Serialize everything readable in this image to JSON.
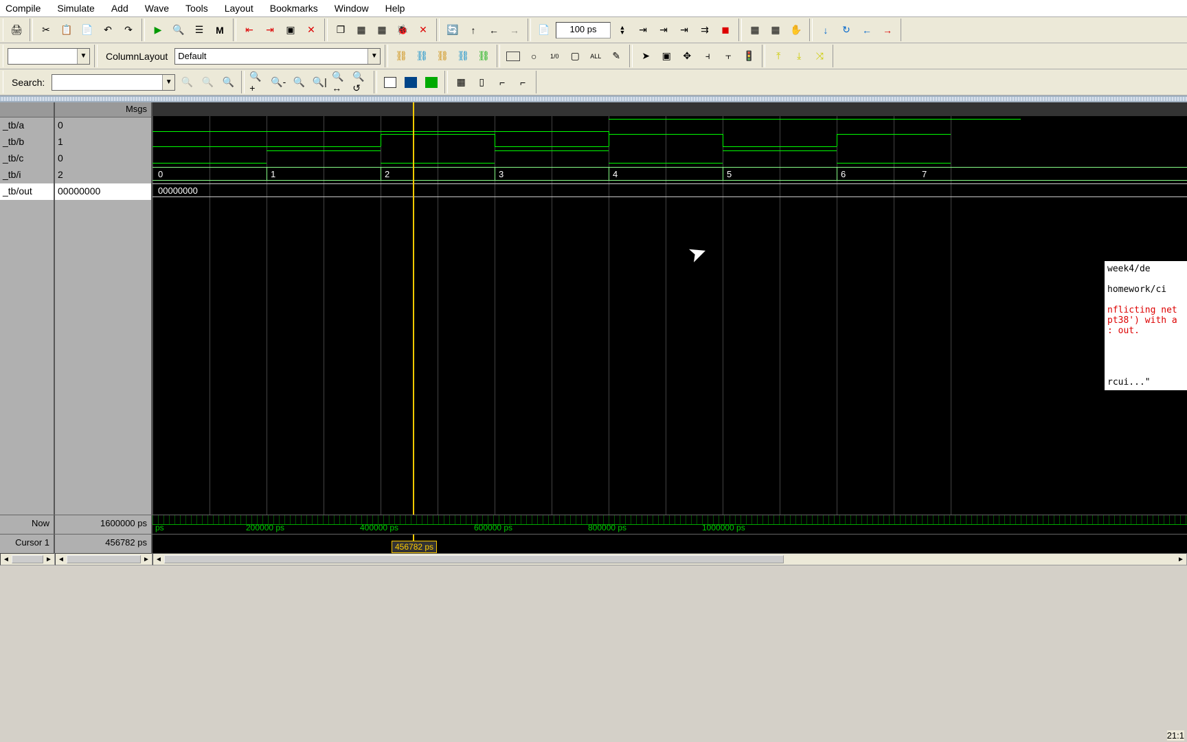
{
  "menu": [
    "Compile",
    "Simulate",
    "Add",
    "Wave",
    "Tools",
    "Layout",
    "Bookmarks",
    "Window",
    "Help"
  ],
  "toolbar": {
    "time_value": "100 ps",
    "column_layout_label": "ColumnLayout",
    "column_layout_value": "Default",
    "search_label": "Search:"
  },
  "signals": {
    "header": "Msgs",
    "rows": [
      {
        "name": "_tb/a",
        "val": "0"
      },
      {
        "name": "_tb/b",
        "val": "1"
      },
      {
        "name": "_tb/c",
        "val": "0"
      },
      {
        "name": "_tb/i",
        "val": "2"
      },
      {
        "name": "_tb/out",
        "val": "00000000"
      }
    ]
  },
  "bus_i": {
    "ticks": [
      "0",
      "1",
      "2",
      "3",
      "4",
      "5",
      "6",
      "7"
    ]
  },
  "bus_out": {
    "label": "00000000"
  },
  "footer": {
    "now_label": "Now",
    "now_val": "1600000 ps",
    "cursor_label": "Cursor 1",
    "cursor_val": "456782 ps",
    "cursor_badge": "456782 ps"
  },
  "ruler": [
    "ps",
    "200000 ps",
    "400000 ps",
    "600000 ps",
    "800000 ps",
    "1000000 ps"
  ],
  "peek": {
    "l1": "week4/de",
    "l2": "homework/ci",
    "r1": "nflicting net",
    "r2": "pt38') with a",
    "r3": ": out.",
    "l3": "rcui...\""
  },
  "clock": "21:1"
}
